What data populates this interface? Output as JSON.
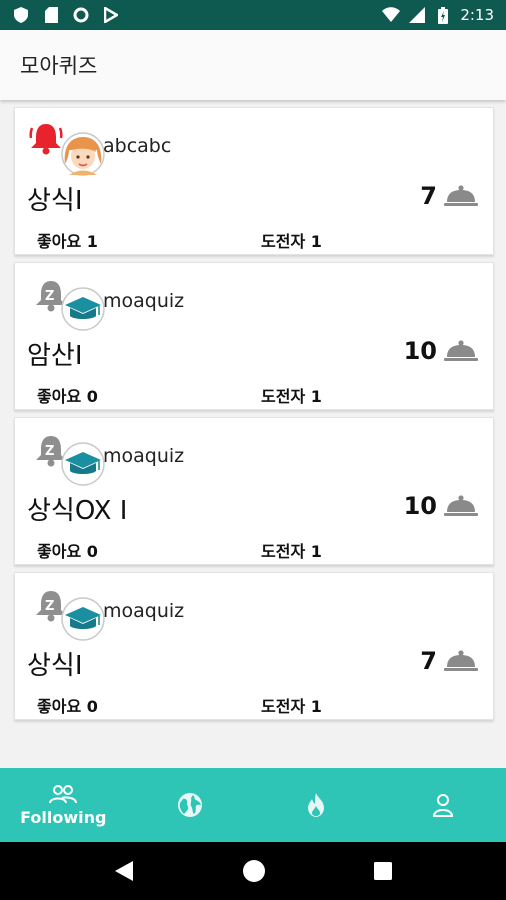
{
  "status": {
    "time": "2:13",
    "icons": [
      "shield-icon",
      "sd-card-icon",
      "circle-icon",
      "download-icon",
      "wifi-icon",
      "signal-icon",
      "battery-icon"
    ]
  },
  "app": {
    "title": "모아퀴즈"
  },
  "cards": [
    {
      "author": "abcabc",
      "title": "상식I",
      "count": "7",
      "likes": "좋아요 1",
      "challengers": "도전자 1",
      "avatar": "girl-avatar",
      "bell": "alarm-bell-icon"
    },
    {
      "author": "moaquiz",
      "title": "암산I",
      "count": "10",
      "likes": "좋아요 0",
      "challengers": "도전자 1",
      "avatar": "graduation-cap-avatar",
      "bell": "snooze-bell-icon"
    },
    {
      "author": "moaquiz",
      "title": "상식OX I",
      "count": "10",
      "likes": "좋아요 0",
      "challengers": "도전자 1",
      "avatar": "graduation-cap-avatar",
      "bell": "snooze-bell-icon"
    },
    {
      "author": "moaquiz",
      "title": "상식I",
      "count": "7",
      "likes": "좋아요 0",
      "challengers": "도전자 1",
      "avatar": "graduation-cap-avatar",
      "bell": "snooze-bell-icon"
    }
  ],
  "nav": {
    "following_label": "Following",
    "items": [
      "people-icon",
      "globe-icon",
      "fire-icon",
      "person-icon"
    ]
  },
  "colors": {
    "accent": "#2ec4b6",
    "status_bar": "#0f5a50",
    "bell_red": "#e8232e",
    "teal_cap": "#1a8fa0"
  }
}
